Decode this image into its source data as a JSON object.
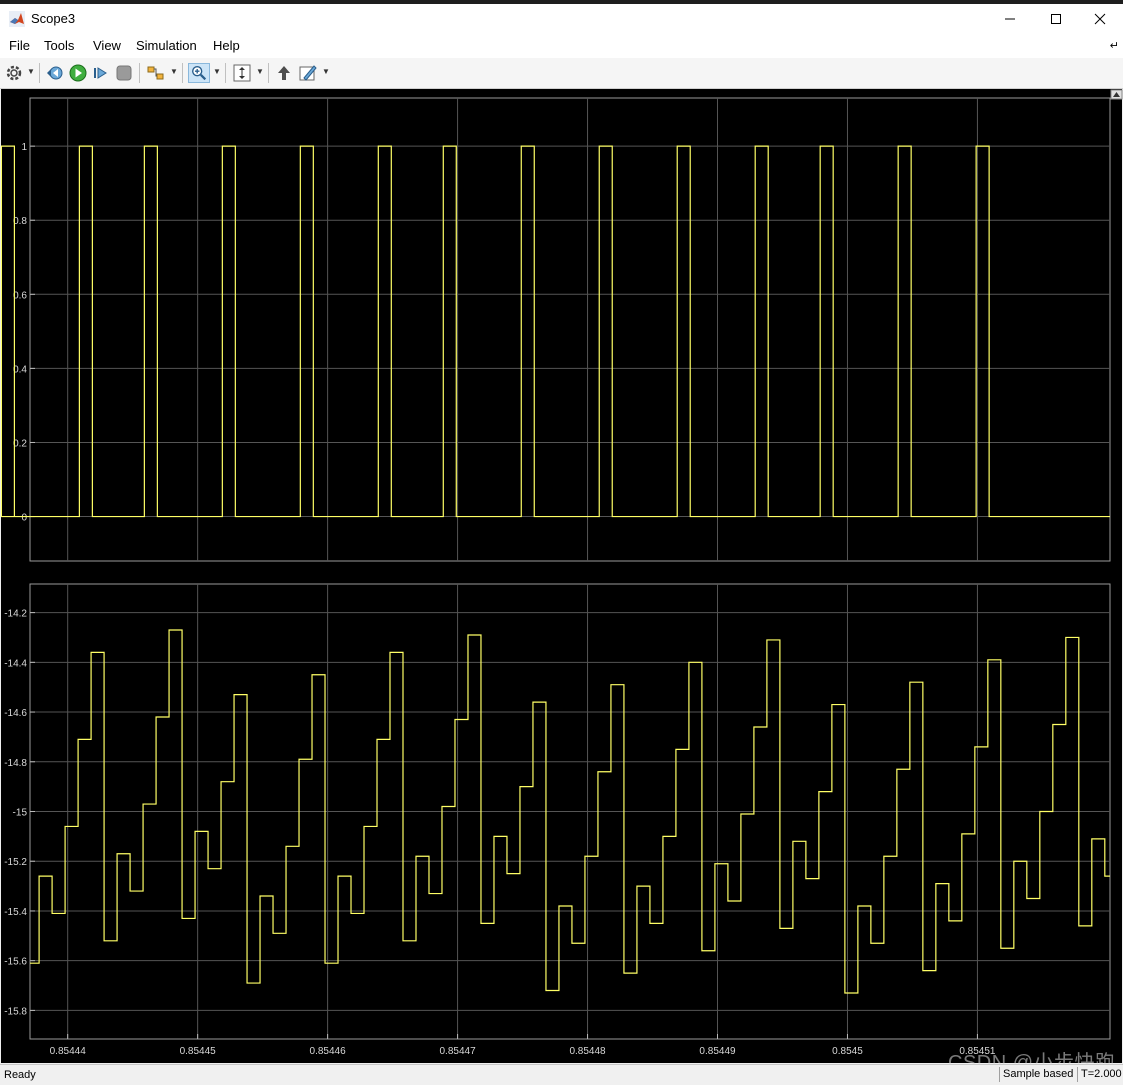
{
  "window": {
    "title": "Scope3"
  },
  "menu": {
    "items": [
      "File",
      "Tools",
      "View",
      "Simulation",
      "Help"
    ]
  },
  "toolbar": {
    "icons": [
      "gear-icon",
      "step-back-icon",
      "run-icon",
      "step-forward-icon",
      "stop-icon",
      "highlight-block-icon",
      "zoom-in-icon",
      "scale-axes-icon",
      "restore-icon",
      "style-icon"
    ]
  },
  "status": {
    "text": "Ready",
    "mode": "Sample based",
    "time": "T=2.000"
  },
  "watermark": "CSDN @小步快跑",
  "colors": {
    "trace": "#ffff66",
    "axes_bg": "#000000",
    "grid": "#555555"
  },
  "chart_data": [
    {
      "type": "line",
      "step": true,
      "title": "",
      "xlabel": "",
      "ylabel": "",
      "ylim": [
        -0.12,
        1.13
      ],
      "yticks": [
        "0",
        "0.2",
        "0.4",
        "0.6",
        "0.8",
        "1"
      ],
      "ytick_values": [
        0,
        0.2,
        0.4,
        0.6,
        0.8,
        1
      ],
      "grid": true,
      "pulses_x": [
        [
          0.8544349,
          0.8544359
        ],
        [
          0.8544409,
          0.8544419
        ],
        [
          0.8544459,
          0.8544469
        ],
        [
          0.8544519,
          0.8544529
        ],
        [
          0.8544579,
          0.8544589
        ],
        [
          0.8544639,
          0.8544649
        ],
        [
          0.8544689,
          0.8544699
        ],
        [
          0.8544749,
          0.8544759
        ],
        [
          0.8544809,
          0.8544819
        ],
        [
          0.8544869,
          0.8544879
        ],
        [
          0.8544929,
          0.8544939
        ],
        [
          0.8544979,
          0.8544989
        ],
        [
          0.8545039,
          0.8545049
        ],
        [
          0.8545099,
          0.8545109
        ]
      ]
    },
    {
      "type": "line",
      "step": true,
      "title": "",
      "xlabel": "",
      "ylabel": "",
      "ylim": [
        -15.915,
        -14.085
      ],
      "yticks": [
        "-15.8",
        "-15.6",
        "-15.4",
        "-15.2",
        "-15",
        "-14.8",
        "-14.6",
        "-14.4",
        "-14.2"
      ],
      "ytick_values": [
        -15.8,
        -15.6,
        -15.4,
        -15.2,
        -15,
        -14.8,
        -14.6,
        -14.4,
        -14.2
      ],
      "xticks": [
        "0.85444",
        "0.85445",
        "0.85446",
        "0.85447",
        "0.85448",
        "0.85449",
        "0.8545",
        "0.85451"
      ],
      "xtick_values": [
        0.85444,
        0.85445,
        0.85446,
        0.85447,
        0.85448,
        0.85449,
        0.8545,
        0.85451
      ],
      "xlim": [
        0.8544371,
        0.8545202
      ],
      "grid": true,
      "x": [
        0.8544371,
        0.8544378,
        0.8544388,
        0.8544398,
        0.8544408,
        0.8544418,
        0.8544428,
        0.8544438,
        0.8544448,
        0.8544458,
        0.8544468,
        0.8544478,
        0.8544488,
        0.8544498,
        0.8544508,
        0.8544518,
        0.8544528,
        0.8544538,
        0.8544548,
        0.8544558,
        0.8544568,
        0.8544578,
        0.8544588,
        0.8544598,
        0.8544608,
        0.8544618,
        0.8544628,
        0.8544638,
        0.8544648,
        0.8544658,
        0.8544668,
        0.8544678,
        0.8544688,
        0.8544698,
        0.8544708,
        0.8544718,
        0.8544728,
        0.8544738,
        0.8544748,
        0.8544758,
        0.8544768,
        0.8544778,
        0.8544788,
        0.8544798,
        0.8544808,
        0.8544818,
        0.8544828,
        0.8544838,
        0.8544848,
        0.8544858,
        0.8544868,
        0.8544878,
        0.8544888,
        0.8544898,
        0.8544908,
        0.8544918,
        0.8544928,
        0.8544938,
        0.8544948,
        0.8544958,
        0.8544968,
        0.8544978,
        0.8544988,
        0.8544998,
        0.8545008,
        0.8545018,
        0.8545028,
        0.8545038,
        0.8545048,
        0.8545058,
        0.8545068,
        0.8545078,
        0.8545088,
        0.8545098,
        0.8545108,
        0.8545118,
        0.8545128,
        0.8545138,
        0.8545148,
        0.8545158,
        0.8545168,
        0.8545178,
        0.8545188,
        0.8545198
      ],
      "values": [
        -15.61,
        -15.26,
        -15.41,
        -15.06,
        -14.71,
        -14.36,
        -15.52,
        -15.17,
        -15.32,
        -14.97,
        -14.62,
        -14.27,
        -15.43,
        -15.08,
        -15.23,
        -14.88,
        -14.53,
        -15.69,
        -15.34,
        -15.49,
        -15.14,
        -14.79,
        -14.45,
        -15.61,
        -15.26,
        -15.41,
        -15.06,
        -14.71,
        -14.36,
        -15.52,
        -15.18,
        -15.33,
        -14.98,
        -14.63,
        -14.29,
        -15.45,
        -15.1,
        -15.25,
        -14.9,
        -14.56,
        -15.72,
        -15.38,
        -15.53,
        -15.18,
        -14.84,
        -14.49,
        -15.65,
        -15.3,
        -15.45,
        -15.1,
        -14.75,
        -14.4,
        -15.56,
        -15.21,
        -15.36,
        -15.01,
        -14.66,
        -14.31,
        -15.47,
        -15.12,
        -15.27,
        -14.92,
        -14.57,
        -15.73,
        -15.38,
        -15.53,
        -15.18,
        -14.83,
        -14.48,
        -15.64,
        -15.29,
        -15.44,
        -15.09,
        -14.74,
        -14.39,
        -15.55,
        -15.2,
        -15.35,
        -15.0,
        -14.65,
        -14.3,
        -15.46,
        -15.11,
        -15.26
      ]
    }
  ]
}
